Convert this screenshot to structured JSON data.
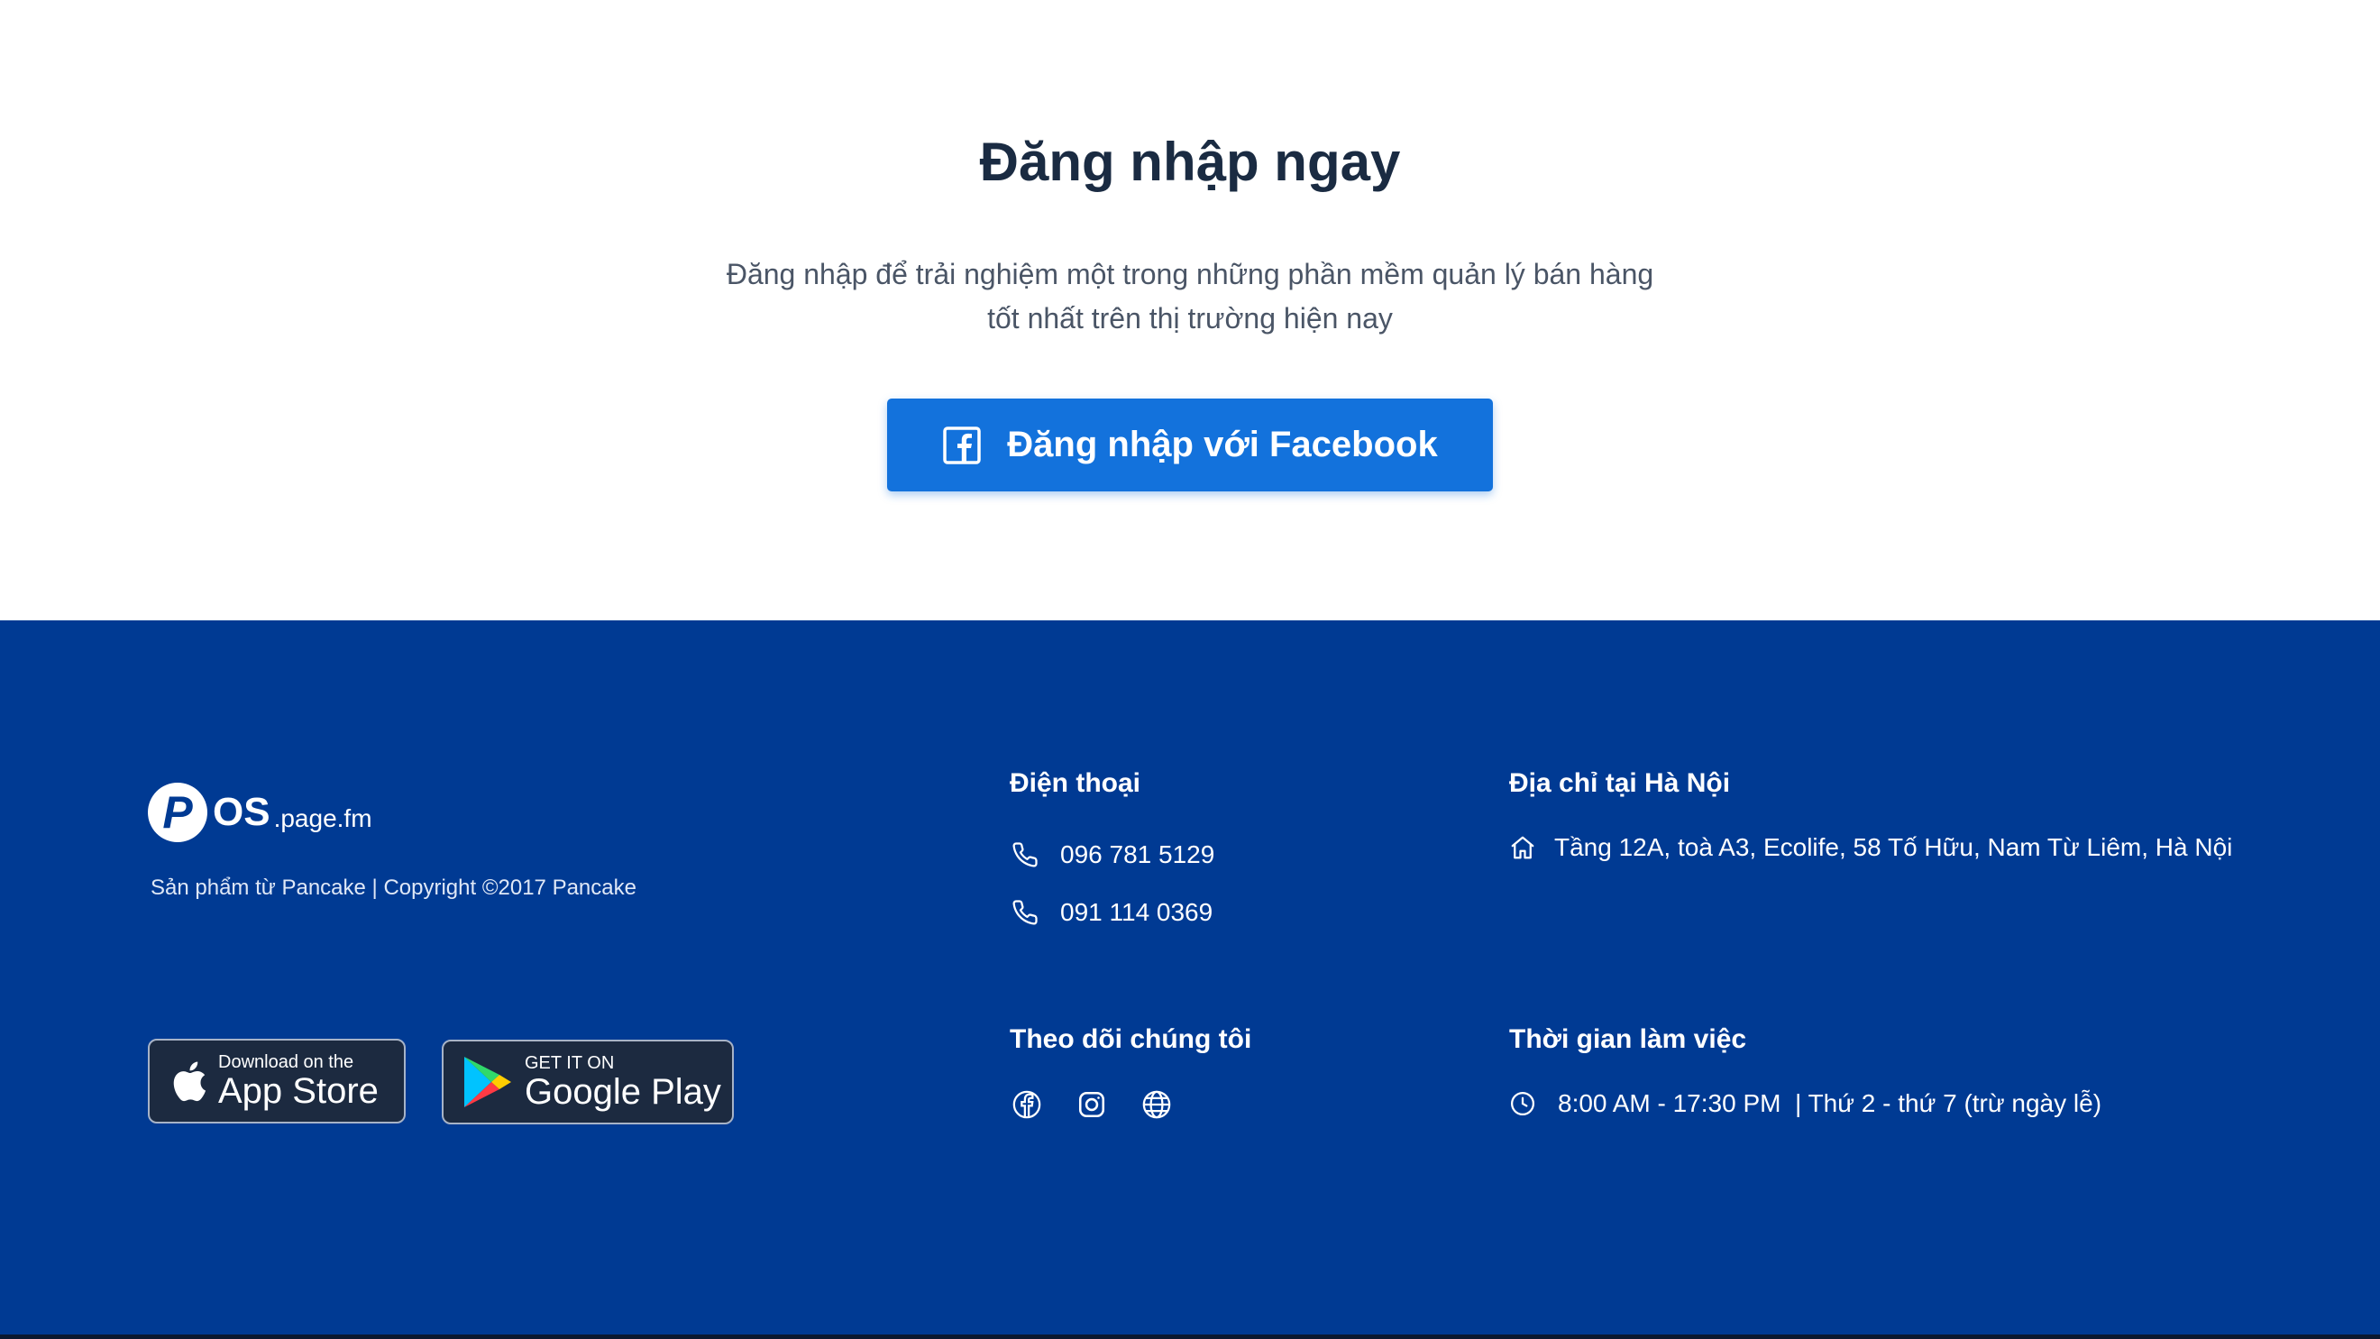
{
  "hero": {
    "title": "Đăng nhập ngay",
    "subtitle_line1": "Đăng nhập để trải nghiệm một trong những phần mềm quản lý bán hàng",
    "subtitle_line2": "tốt nhất trên thị trường hiện nay",
    "facebook_button_label": "Đăng nhập với Facebook"
  },
  "footer": {
    "logo_letter": "P",
    "logo_name": "OS",
    "logo_domain": ".page.fm",
    "copyright": "Sản phẩm từ Pancake | Copyright ©2017 Pancake",
    "app_store": {
      "small": "Download on the",
      "big": "App Store"
    },
    "google_play": {
      "small": "GET IT ON",
      "big": "Google Play"
    },
    "phone": {
      "title": "Điện thoại",
      "numbers": [
        "096 781 5129",
        "091 114 0369"
      ]
    },
    "address": {
      "title": "Địa chỉ tại Hà Nội",
      "text": "Tầng 12A, toà A3, Ecolife, 58 Tố Hữu, Nam Từ Liêm, Hà Nội"
    },
    "follow": {
      "title": "Theo dõi chúng tôi",
      "icons": [
        "facebook-icon",
        "instagram-icon",
        "globe-icon"
      ]
    },
    "hours": {
      "title": "Thời gian làm việc",
      "text": "8:00 AM - 17:30 PM  | Thứ 2 - thứ 7 (trừ ngày lễ)"
    }
  },
  "colors": {
    "primary_button": "#1372dc",
    "footer_bg": "#003a93",
    "title_text": "#1a2b42"
  }
}
